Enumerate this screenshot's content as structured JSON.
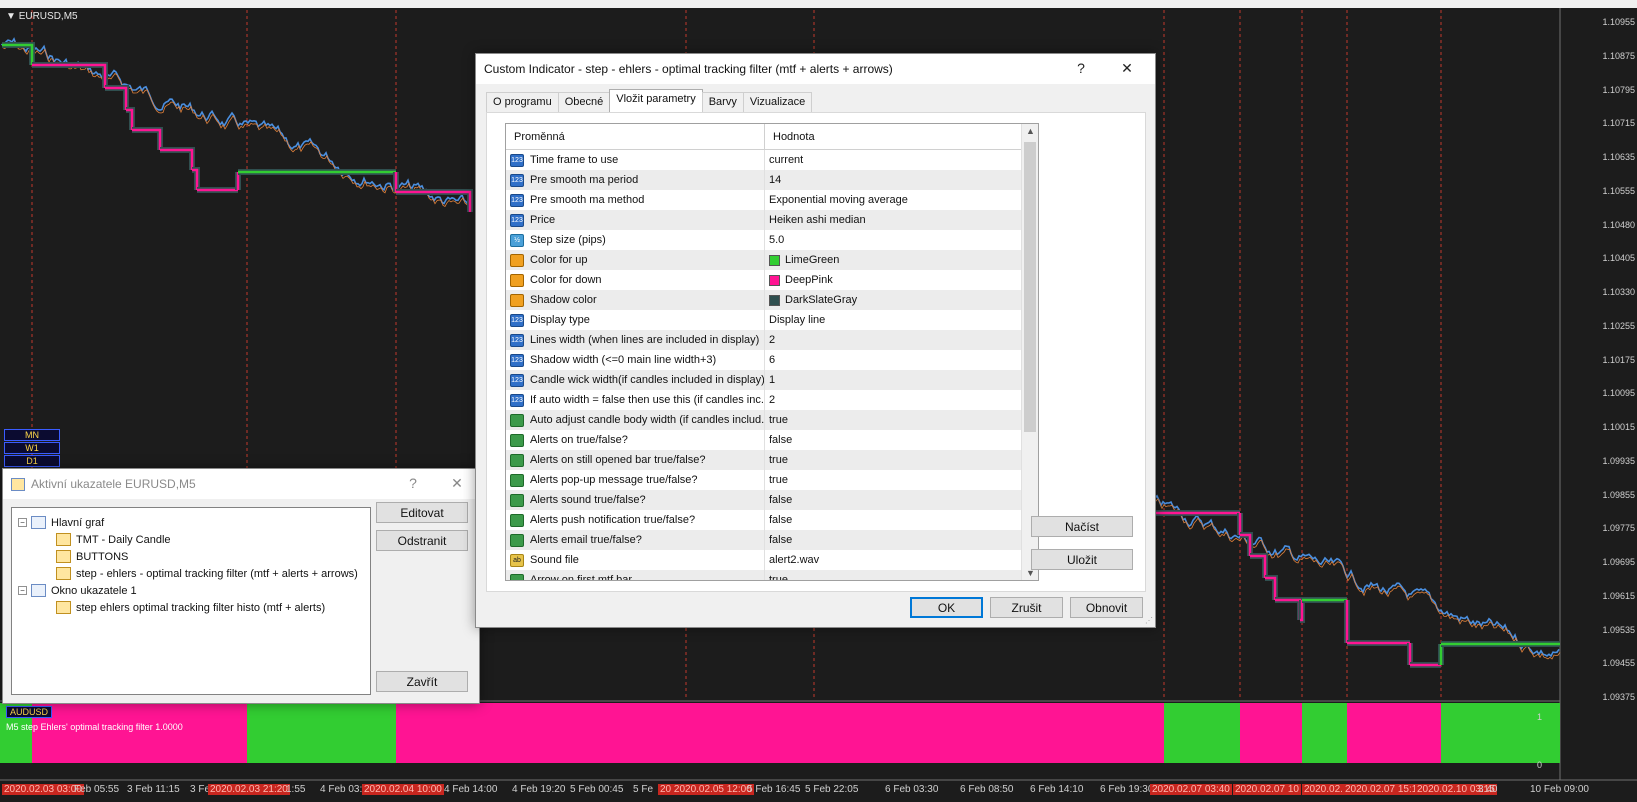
{
  "chart": {
    "symbol": "EURUSD,M5",
    "subwindow_title": "M5 step Ehlers' optimal tracking filter 1.0000",
    "aud_label": "AUDUSD",
    "tf_boxes": [
      "MN",
      "W1",
      "D1"
    ],
    "colors": {
      "up": "#32cd32",
      "down": "#ff1493",
      "candle_up": "#4a8fe0",
      "candle_down": "#e0803a",
      "vline": "#c0392b"
    },
    "price_labels": [
      "1.10955",
      "1.10875",
      "1.10795",
      "1.10715",
      "1.10635",
      "1.10555",
      "1.10480",
      "1.10405",
      "1.10330",
      "1.10255",
      "1.10175",
      "1.10095",
      "1.10015",
      "1.09935",
      "1.09855",
      "1.09775",
      "1.09695",
      "1.09615",
      "1.09535",
      "1.09455",
      "1.09375"
    ],
    "sub_price_labels": [
      "1",
      "0"
    ],
    "time_labels": [
      {
        "text": "2020.02.03 03:00",
        "red": true
      },
      {
        "text": "Feb 05:55",
        "red": false
      },
      {
        "text": "3 Feb 11:15",
        "red": false
      },
      {
        "text": "3 Fe",
        "red": false
      },
      {
        "text": "2020.02.03 21:20",
        "red": true
      },
      {
        "text": "1:55",
        "red": false
      },
      {
        "text": "4 Feb 03:",
        "red": false
      },
      {
        "text": "2020.02.04 10:00",
        "red": true
      },
      {
        "text": "4 Feb 14:00",
        "red": false
      },
      {
        "text": "4 Feb 19:20",
        "red": false
      },
      {
        "text": "5 Feb 00:45",
        "red": false
      },
      {
        "text": "5 Fe",
        "red": false
      },
      {
        "text": "20 2020.02.05 12:00",
        "red": true
      },
      {
        "text": "5 Feb 16:45",
        "red": false
      },
      {
        "text": "5 Feb 22:05",
        "red": false
      },
      {
        "text": "6 Feb 03:30",
        "red": false
      },
      {
        "text": "6 Feb 08:50",
        "red": false
      },
      {
        "text": "6 Feb 14:10",
        "red": false
      },
      {
        "text": "6 Feb 19:30",
        "red": false
      },
      {
        "text": "2020.02.07 03:40",
        "red": true
      },
      {
        "text": "2020.02.07 10",
        "red": true
      },
      {
        "text": "2020.02.0",
        "red": true
      },
      {
        "text": "2020.02.07 15:10",
        "red": true
      },
      {
        "text": "2020.02.10 03:15",
        "red": true
      },
      {
        "text": "3:40",
        "red": false
      },
      {
        "text": "10 Feb 09:00",
        "red": false
      }
    ]
  },
  "ci_dialog": {
    "title": "Custom Indicator - step - ehlers - optimal tracking filter (mtf + alerts + arrows)",
    "help": "?",
    "close": "✕",
    "tabs": [
      "O programu",
      "Obecné",
      "Vložit parametry",
      "Barvy",
      "Vizualizace"
    ],
    "active_tab": 2,
    "col_variable": "Proměnná",
    "col_value": "Hodnota",
    "params": [
      {
        "icon": "num",
        "name": "Time frame to use",
        "value": "current"
      },
      {
        "icon": "num",
        "name": "Pre smooth ma period",
        "value": "14"
      },
      {
        "icon": "num",
        "name": "Pre smooth ma method",
        "value": "Exponential moving average"
      },
      {
        "icon": "num",
        "name": "Price",
        "value": "Heiken ashi median"
      },
      {
        "icon": "dbl",
        "name": "Step size (pips)",
        "value": "5.0"
      },
      {
        "icon": "col",
        "name": "Color for up",
        "value": "LimeGreen",
        "swatch": "#32cd32"
      },
      {
        "icon": "col",
        "name": "Color for down",
        "value": "DeepPink",
        "swatch": "#ff1493"
      },
      {
        "icon": "col",
        "name": "Shadow color",
        "value": "DarkSlateGray",
        "swatch": "#2f4f4f"
      },
      {
        "icon": "num",
        "name": "Display type",
        "value": "Display line"
      },
      {
        "icon": "num",
        "name": "Lines width (when lines are included in display)",
        "value": "2"
      },
      {
        "icon": "num",
        "name": "Shadow width (<=0 main line width+3)",
        "value": "6"
      },
      {
        "icon": "num",
        "name": "Candle wick width(if candles included in display)",
        "value": "1"
      },
      {
        "icon": "num",
        "name": "If auto width = false then use this (if candles inc...",
        "value": "2"
      },
      {
        "icon": "bool",
        "name": "Auto adjust candle body width (if candles includ...",
        "value": "true"
      },
      {
        "icon": "bool",
        "name": "Alerts on true/false?",
        "value": "false"
      },
      {
        "icon": "bool",
        "name": "Alerts on still opened bar true/false?",
        "value": "true"
      },
      {
        "icon": "bool",
        "name": "Alerts pop-up message true/false?",
        "value": "true"
      },
      {
        "icon": "bool",
        "name": "Alerts sound true/false?",
        "value": "false"
      },
      {
        "icon": "bool",
        "name": "Alerts push notification true/false?",
        "value": "false"
      },
      {
        "icon": "bool",
        "name": "Alerts email true/false?",
        "value": "false"
      },
      {
        "icon": "str",
        "name": "Sound file",
        "value": "alert2.wav"
      },
      {
        "icon": "bool",
        "name": "Arrow on first mtf bar",
        "value": "true"
      }
    ],
    "icon_labels": {
      "num": "123",
      "dbl": "½",
      "col": "",
      "bool": "",
      "str": "ab"
    },
    "load_label": "Načíst",
    "save_label": "Uložit",
    "ok_label": "OK",
    "cancel_label": "Zrušit",
    "reset_label": "Obnovit"
  },
  "ai_dialog": {
    "title": "Aktivní ukazatele EURUSD,M5",
    "help": "?",
    "close": "✕",
    "tree": [
      {
        "level": 0,
        "type": "window",
        "label": "Hlavní graf"
      },
      {
        "level": 1,
        "type": "ind",
        "label": "TMT - Daily Candle"
      },
      {
        "level": 1,
        "type": "ind",
        "label": "BUTTONS"
      },
      {
        "level": 1,
        "type": "ind",
        "label": "step - ehlers - optimal tracking filter (mtf + alerts + arrows)"
      },
      {
        "level": 0,
        "type": "window",
        "label": "Okno ukazatele 1"
      },
      {
        "level": 1,
        "type": "ind",
        "label": "step ehlers optimal tracking filter histo (mtf + alerts)"
      }
    ],
    "edit_label": "Editovat",
    "remove_label": "Odstranit",
    "close_label": "Zavřít"
  }
}
